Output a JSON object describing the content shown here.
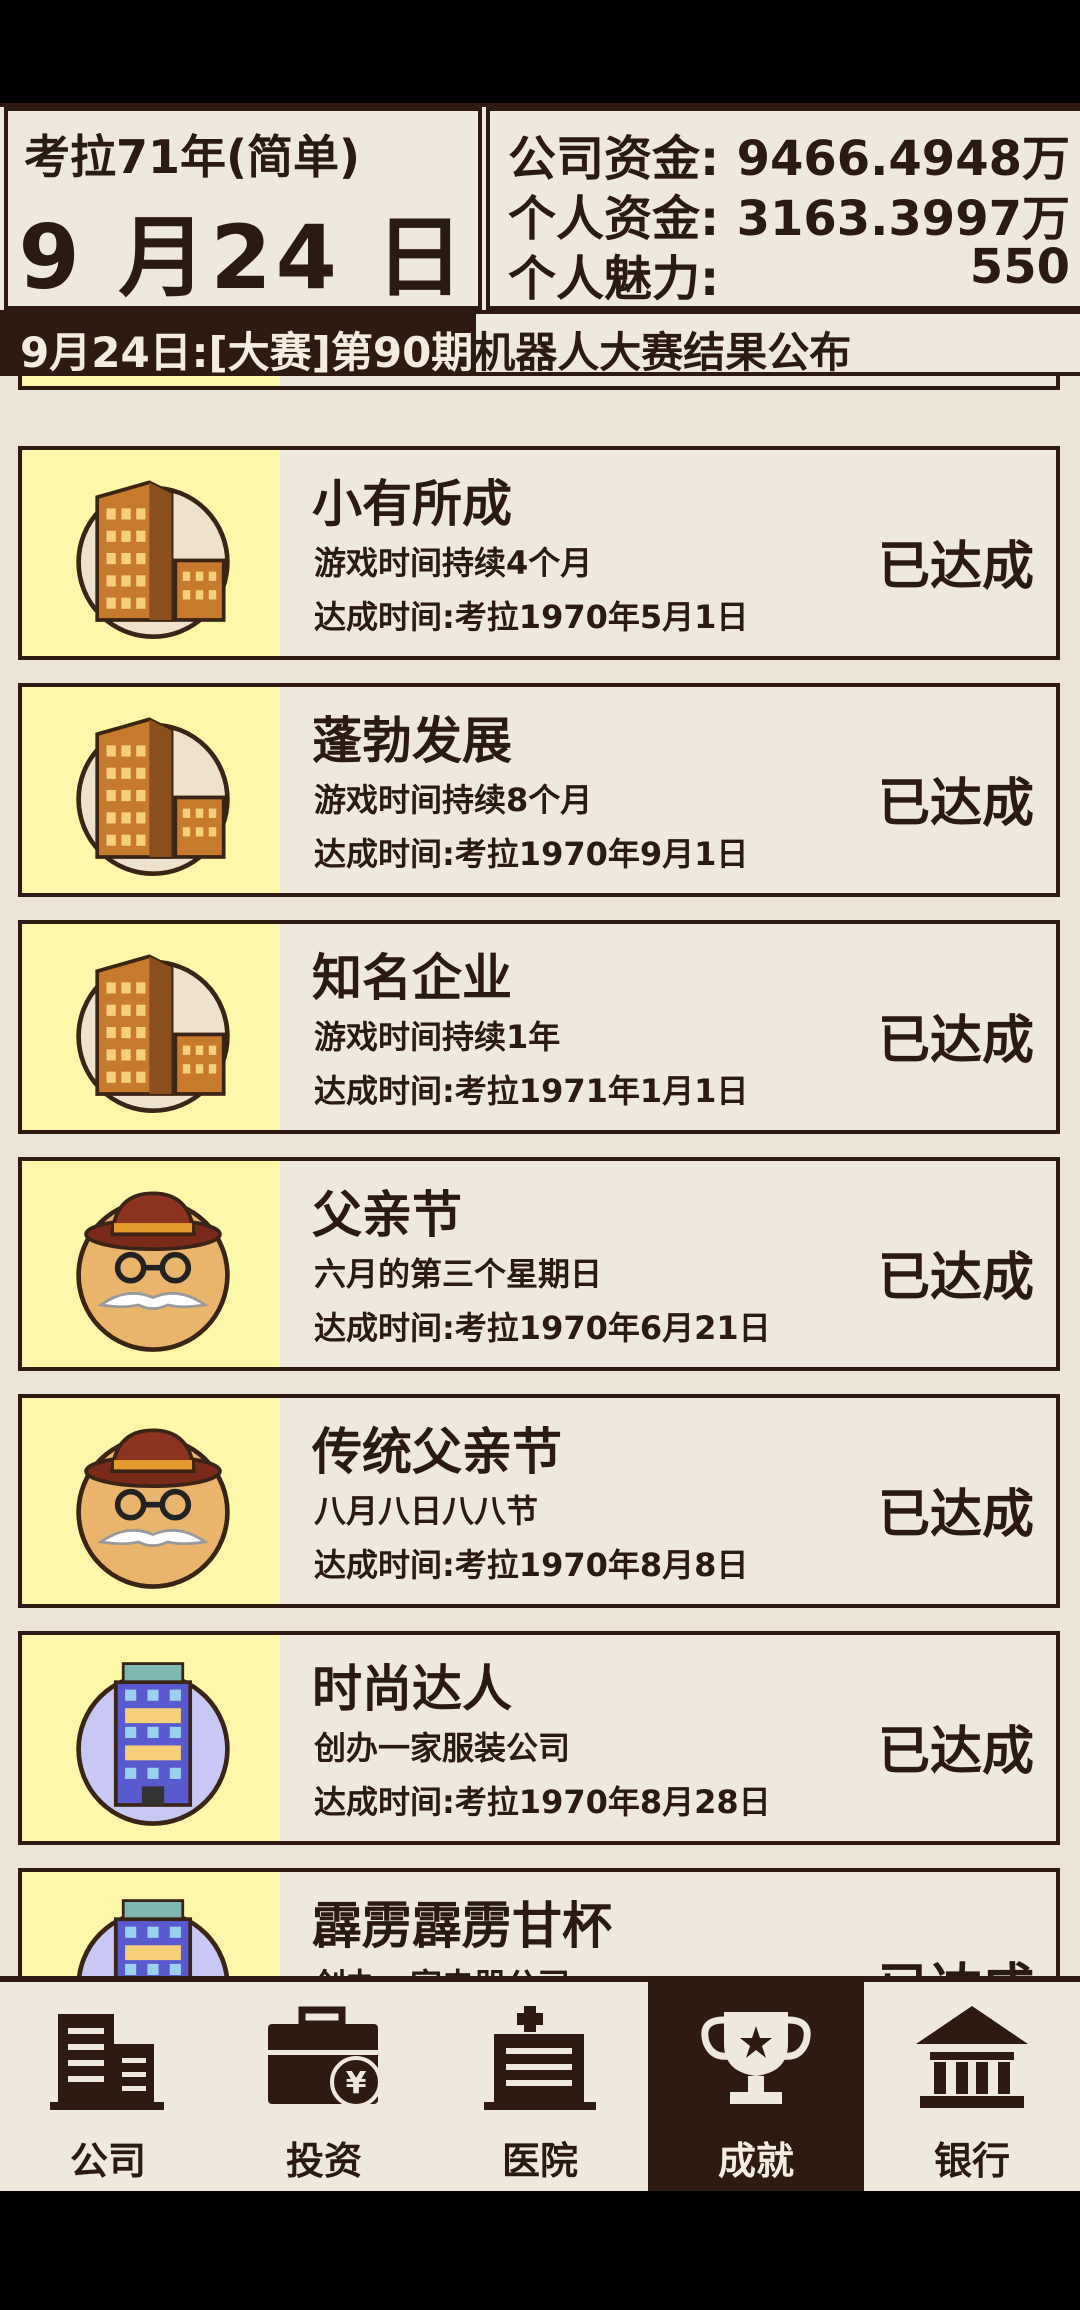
{
  "header": {
    "game_year": "考拉71年(简单)",
    "game_date": "9 月24 日",
    "stats": [
      {
        "label": "公司资金:",
        "value": "9466.4948万"
      },
      {
        "label": "个人资金:",
        "value": "3163.3997万"
      },
      {
        "label": "个人魅力:",
        "value": "550"
      }
    ]
  },
  "news": {
    "text": "9月24日:[大赛]第90期机器人大赛结果公布"
  },
  "achievements": [
    {
      "title": "小有所成",
      "desc": "游戏时间持续4个月",
      "time": "达成时间:考拉1970年5月1日",
      "status": "已达成",
      "icon": "office-building-icon"
    },
    {
      "title": "蓬勃发展",
      "desc": "游戏时间持续8个月",
      "time": "达成时间:考拉1970年9月1日",
      "status": "已达成",
      "icon": "office-building-icon"
    },
    {
      "title": "知名企业",
      "desc": "游戏时间持续1年",
      "time": "达成时间:考拉1971年1月1日",
      "status": "已达成",
      "icon": "office-building-icon"
    },
    {
      "title": "父亲节",
      "desc": "六月的第三个星期日",
      "time": "达成时间:考拉1970年6月21日",
      "status": "已达成",
      "icon": "father-hat-mustache-icon"
    },
    {
      "title": "传统父亲节",
      "desc": "八月八日八八节",
      "time": "达成时间:考拉1970年8月8日",
      "status": "已达成",
      "icon": "father-hat-mustache-icon"
    },
    {
      "title": "时尚达人",
      "desc": "创办一家服装公司",
      "time": "达成时间:考拉1970年8月28日",
      "status": "已达成",
      "icon": "tower-building-icon"
    },
    {
      "title": "霹雳霹雳甘杯",
      "desc": "创办一家电器公司",
      "time": "",
      "status": "已达成",
      "icon": "tower-building-icon"
    }
  ],
  "nav": [
    {
      "label": "公司",
      "icon": "company-icon"
    },
    {
      "label": "投资",
      "icon": "briefcase-yen-icon"
    },
    {
      "label": "医院",
      "icon": "hospital-icon"
    },
    {
      "label": "成就",
      "icon": "trophy-icon"
    },
    {
      "label": "银行",
      "icon": "bank-icon"
    }
  ],
  "colors": {
    "dark_brown": "#2e1a10",
    "paper": "#efe8dc",
    "icon_highlight": "#fdf7a9"
  }
}
